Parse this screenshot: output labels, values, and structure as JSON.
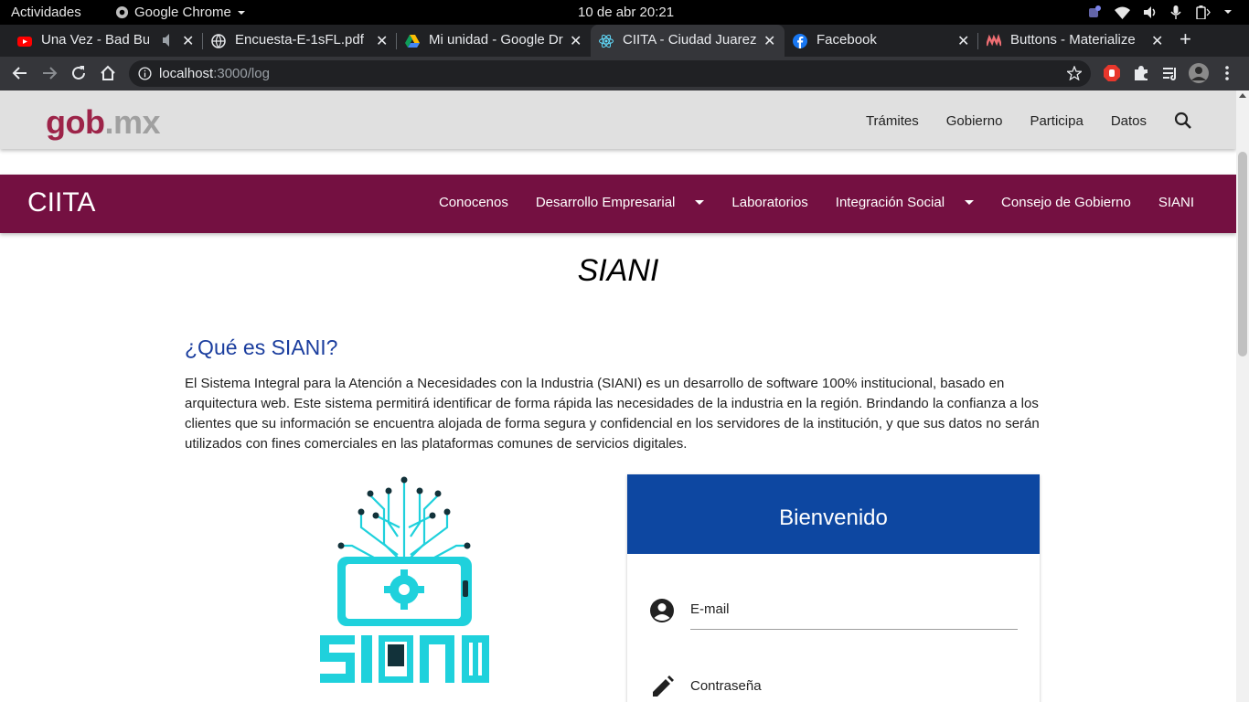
{
  "system": {
    "activities": "Actividades",
    "app_name": "Google Chrome",
    "clock": "10 de abr  20:21"
  },
  "tabs": [
    {
      "title": "Una Vez - Bad Bunny",
      "favicon": "youtube-icon",
      "active": false
    },
    {
      "title": "Encuesta-E-1sFL.pdf",
      "favicon": "globe-icon",
      "active": false
    },
    {
      "title": "Mi unidad - Google Drive",
      "favicon": "drive-icon",
      "active": false
    },
    {
      "title": "CIITA - Ciudad Juarez",
      "favicon": "react-icon",
      "active": true
    },
    {
      "title": "Facebook",
      "favicon": "facebook-icon",
      "active": false
    },
    {
      "title": "Buttons - Materialize",
      "favicon": "materialize-icon",
      "active": false
    }
  ],
  "browser": {
    "url_host": "localhost",
    "url_path": ":3000/log"
  },
  "gob": {
    "logo_main": "gob",
    "logo_dot": ".mx",
    "nav": [
      "Trámites",
      "Gobierno",
      "Participa",
      "Datos"
    ]
  },
  "ciita": {
    "brand": "CIITA",
    "nav": [
      "Conocenos",
      "Desarrollo Empresarial",
      "Laboratorios",
      "Integración Social",
      "Consejo de Gobierno",
      "SIANI"
    ]
  },
  "content": {
    "title": "SIANI",
    "question": "¿Qué es SIANI?",
    "description": "El Sistema Integral para la Atención a Necesidades con la Industria (SIANI) es un desarrollo de software 100% institucional, basado en arquitectura web. Este sistema permitirá identificar de forma rápida las necesidades de la industria en la región. Brindando la confianza a los clientes que su información se encuentra alojada de forma segura y confidencial en los servidores de la institución, y que sus datos no serán utilizados con fines comerciales en las plataformas comunes de servicios digitales."
  },
  "login": {
    "header": "Bienvenido",
    "email_label": "E-mail",
    "password_label": "Contraseña"
  },
  "colors": {
    "gob_red": "#9d2449",
    "ciita_bar": "#741041",
    "card_header": "#0d47a1",
    "heading_blue": "#1a3d9e",
    "logo_cyan": "#1fd1dc"
  }
}
